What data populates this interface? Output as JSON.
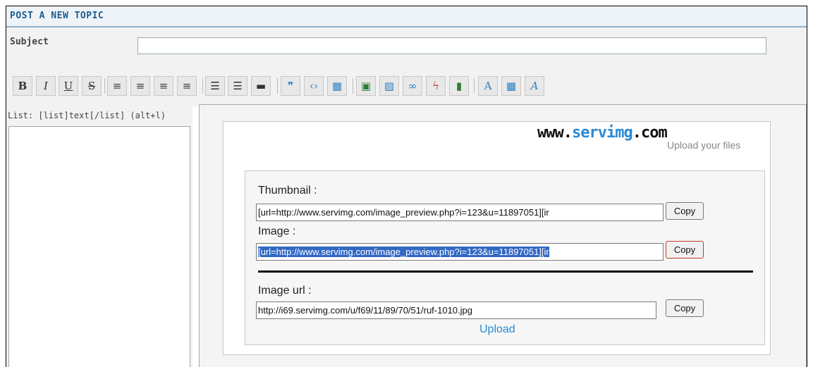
{
  "header": {
    "title": "POST A NEW TOPIC"
  },
  "subject": {
    "label": "Subject",
    "value": ""
  },
  "toolbar": {
    "buttons": [
      {
        "name": "bold",
        "glyph": "B"
      },
      {
        "name": "italic",
        "glyph": "I"
      },
      {
        "name": "underline",
        "glyph": "U"
      },
      {
        "name": "strikethrough",
        "glyph": "S"
      },
      {
        "name": "align-left",
        "glyph": "≡"
      },
      {
        "name": "align-center",
        "glyph": "≡"
      },
      {
        "name": "align-right",
        "glyph": "≡"
      },
      {
        "name": "justify",
        "glyph": "≡"
      },
      {
        "name": "list",
        "glyph": "☰"
      },
      {
        "name": "numbered-list",
        "glyph": "☰"
      },
      {
        "name": "horizontal-rule",
        "glyph": "▬"
      },
      {
        "name": "quote",
        "glyph": "❞"
      },
      {
        "name": "code",
        "glyph": "‹›"
      },
      {
        "name": "table",
        "glyph": "▦"
      },
      {
        "name": "image-host",
        "glyph": "▣"
      },
      {
        "name": "image",
        "glyph": "▨"
      },
      {
        "name": "link",
        "glyph": "∞"
      },
      {
        "name": "flash",
        "glyph": "ϟ"
      },
      {
        "name": "video",
        "glyph": "▮"
      },
      {
        "name": "font-size",
        "glyph": "A"
      },
      {
        "name": "color",
        "glyph": "▩"
      },
      {
        "name": "font-face",
        "glyph": "A"
      }
    ]
  },
  "editor": {
    "help_text": "List: [list]text[/list] (alt+l)",
    "content": ""
  },
  "popup": {
    "logo": {
      "prefix": "www.",
      "brand": "servimg",
      "suffix": ".com",
      "tagline": "Upload your files"
    },
    "thumbnail": {
      "label": "Thumbnail :",
      "value": "[url=http://www.servimg.com/image_preview.php?i=123&u=11897051][ir",
      "copy_label": "Copy"
    },
    "image": {
      "label": "Image :",
      "value": "[url=http://www.servimg.com/image_preview.php?i=123&u=11897051][ir",
      "copy_label": "Copy"
    },
    "image_url": {
      "label": "Image url :",
      "value": "http://i69.servimg.com/u/f69/11/89/70/51/ruf-1010.jpg",
      "copy_label": "Copy"
    },
    "upload_label": "Upload"
  },
  "colors": {
    "header_text": "#1b5d8f",
    "accent": "#2a8ad4",
    "selection": "#3168c4",
    "active_border": "#c0392b"
  }
}
